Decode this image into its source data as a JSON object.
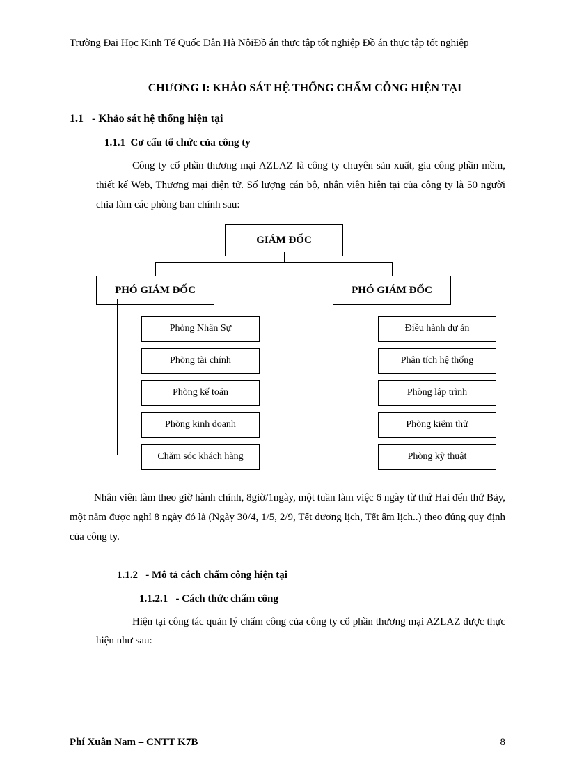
{
  "header": "Trường Đại Học Kinh Tế Quốc Dân Hà NộiĐồ án thực tập tốt nghiệp   Đồ án thực tập tốt nghiệp",
  "chapter_title": "CHƯƠNG I: KHẢO SÁT HỆ THỐNG CHẤM CỖNG HIỆN TẠI",
  "section_1_1_num": "1.1",
  "section_1_1_title": "- Khảo sát hệ thống hiện tại",
  "section_1_1_1_num": "1.1.1",
  "section_1_1_1_title": "Cơ cấu tổ chức của công ty",
  "para_intro": "Công ty cổ phần thương mại AZLAZ là công ty chuyên sản xuất, gia công phần mềm, thiết kế Web, Thương mại điện tử. Số lượng cán bộ, nhân viên hiện tại của công ty là 50 người chia làm các phòng ban chính sau:",
  "para_after_chart": "Nhân viên làm theo giờ hành chính, 8giờ/1ngày, một tuần làm việc 6 ngày từ thứ Hai đến thứ Bảy, một năm được nghỉ 8 ngày đó là (Ngày 30/4, 1/5, 2/9, Tết dương lịch, Tết âm lịch..) theo đúng quy định của công ty.",
  "section_1_1_2_num": "1.1.2",
  "section_1_1_2_title": "- Mô tả cách chấm công hiện tại",
  "section_1_1_2_1_num": "1.1.2.1",
  "section_1_1_2_1_title": "- Cách thức chấm công",
  "para_1121": "Hiện tại công tác quản lý chấm công của công ty cổ phần thương mại AZLAZ được thực hiện như sau:",
  "footer_left": "Phí Xuân Nam – CNTT K7B",
  "footer_right": "8",
  "chart_data": {
    "type": "org-hierarchy",
    "root": "GIÁM ĐỐC",
    "children": [
      {
        "name": "PHÓ GIÁM ĐỐC",
        "departments": [
          "Phòng Nhân Sự",
          "Phòng tài chính",
          "Phòng kế toán",
          "Phòng kinh doanh",
          "Chăm sóc khách hàng"
        ]
      },
      {
        "name": "PHÓ GIÁM ĐỐC",
        "departments": [
          "Điều hành dự án",
          "Phân tích hệ thống",
          "Phòng lập trình",
          "Phòng kiểm thử",
          "Phòng kỹ thuật"
        ]
      }
    ]
  }
}
